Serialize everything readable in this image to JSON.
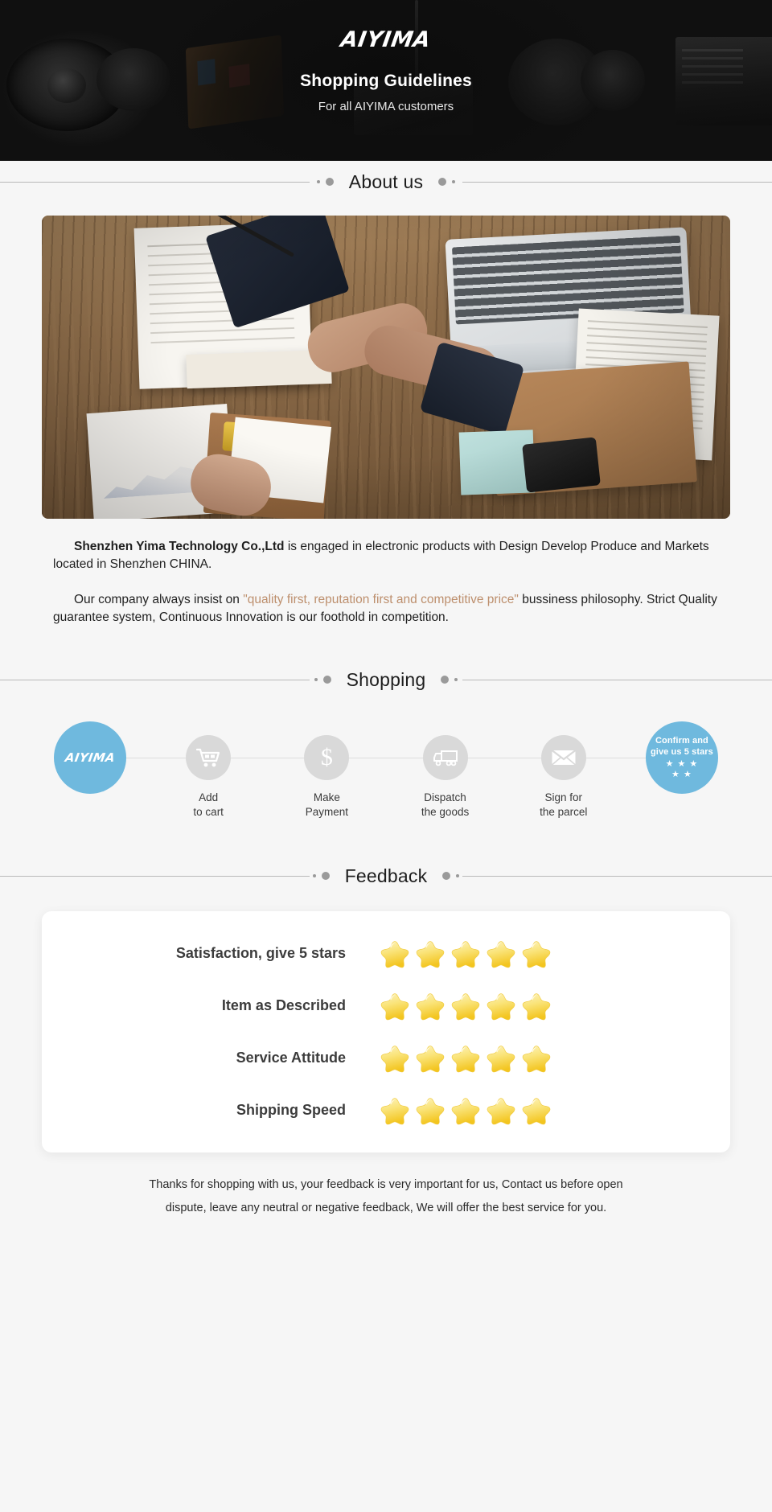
{
  "hero": {
    "brand": "AIYIMA",
    "title": "Shopping Guidelines",
    "subtitle": "For all AIYIMA customers"
  },
  "sections": {
    "about": "About us",
    "shopping": "Shopping",
    "feedback": "Feedback"
  },
  "about": {
    "paragraph1_strong": "Shenzhen Yima Technology Co.,Ltd",
    "paragraph1_rest": " is engaged in electronic products with Design Develop Produce and Markets located in Shenzhen CHINA.",
    "paragraph2_lead": "Our company always insist on ",
    "paragraph2_quote": "\"quality first, reputation first and competitive price\"",
    "paragraph2_rest": " bussiness philosophy. Strict Quality guarantee system, Continuous Innovation is our foothold in competition."
  },
  "steps": [
    {
      "icon": "aiyima-logo-icon",
      "logo": "AIYIMA",
      "label_line1": "",
      "label_line2": ""
    },
    {
      "icon": "shopping-cart-icon",
      "label_line1": "Add",
      "label_line2": "to cart"
    },
    {
      "icon": "dollar-icon",
      "glyph": "$",
      "label_line1": "Make",
      "label_line2": "Payment"
    },
    {
      "icon": "truck-icon",
      "label_line1": "Dispatch",
      "label_line2": "the goods"
    },
    {
      "icon": "envelope-icon",
      "label_line1": "Sign for",
      "label_line2": "the parcel"
    },
    {
      "icon": "confirm-stars-icon",
      "confirm_line1": "Confirm and",
      "confirm_line2": "give us 5 stars",
      "stars_row1": "★ ★ ★",
      "stars_row2": "★ ★",
      "label_line1": "",
      "label_line2": ""
    }
  ],
  "feedback_rows": [
    {
      "label": "Satisfaction, give 5 stars",
      "stars": 5
    },
    {
      "label": "Item as Described",
      "stars": 5
    },
    {
      "label": "Service Attitude",
      "stars": 5
    },
    {
      "label": "Shipping Speed",
      "stars": 5
    }
  ],
  "footer": {
    "line1": "Thanks for shopping with us, your feedback is very important for us, Contact us before open",
    "line2": "dispute, leave any neutral or negative feedback, We will offer the best service for you."
  },
  "colors": {
    "accent_blue": "#6fb9de",
    "quote_brown": "#bd8f6d",
    "star_yellow": "#f7d548",
    "page_bg": "#f6f6f6",
    "hero_bg": "#121212"
  }
}
